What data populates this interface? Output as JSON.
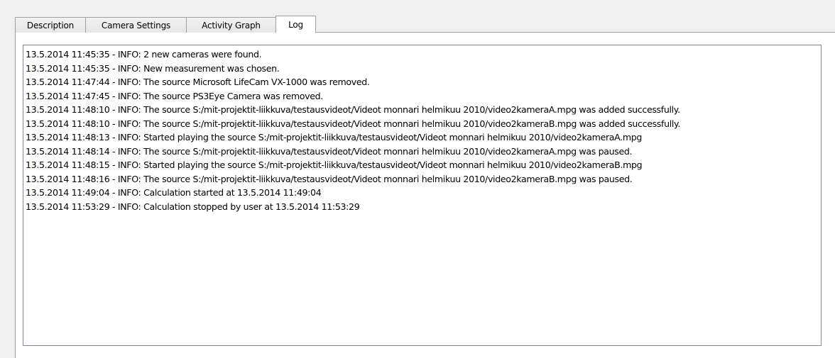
{
  "tabs": [
    {
      "label": "Description",
      "active": false
    },
    {
      "label": "Camera Settings",
      "active": false
    },
    {
      "label": "Activity Graph",
      "active": false
    },
    {
      "label": "Log",
      "active": true
    }
  ],
  "log": {
    "lines": [
      "13.5.2014 11:45:35 - INFO: 2 new cameras were found.",
      "13.5.2014 11:45:35 - INFO: New measurement was chosen.",
      "13.5.2014 11:47:44 - INFO: The source Microsoft LifeCam VX-1000 was removed.",
      "13.5.2014 11:47:45 - INFO: The source PS3Eye Camera was removed.",
      "13.5.2014 11:48:10 - INFO: The source S:/mit-projektit-liikkuva/testausvideot/Videot monnari helmikuu 2010/video2kameraA.mpg was added successfully.",
      "13.5.2014 11:48:10 - INFO: The source S:/mit-projektit-liikkuva/testausvideot/Videot monnari helmikuu 2010/video2kameraB.mpg was added successfully.",
      "13.5.2014 11:48:13 - INFO: Started playing the source S:/mit-projektit-liikkuva/testausvideot/Videot monnari helmikuu 2010/video2kameraA.mpg",
      "13.5.2014 11:48:14 - INFO: The source S:/mit-projektit-liikkuva/testausvideot/Videot monnari helmikuu 2010/video2kameraA.mpg was paused.",
      "13.5.2014 11:48:15 - INFO: Started playing the source S:/mit-projektit-liikkuva/testausvideot/Videot monnari helmikuu 2010/video2kameraB.mpg",
      "13.5.2014 11:48:16 - INFO: The source S:/mit-projektit-liikkuva/testausvideot/Videot monnari helmikuu 2010/video2kameraB.mpg was paused.",
      "13.5.2014 11:49:04 - INFO: Calculation started at 13.5.2014 11:49:04",
      "13.5.2014 11:53:29 - INFO: Calculation stopped by user at 13.5.2014 11:53:29"
    ]
  }
}
